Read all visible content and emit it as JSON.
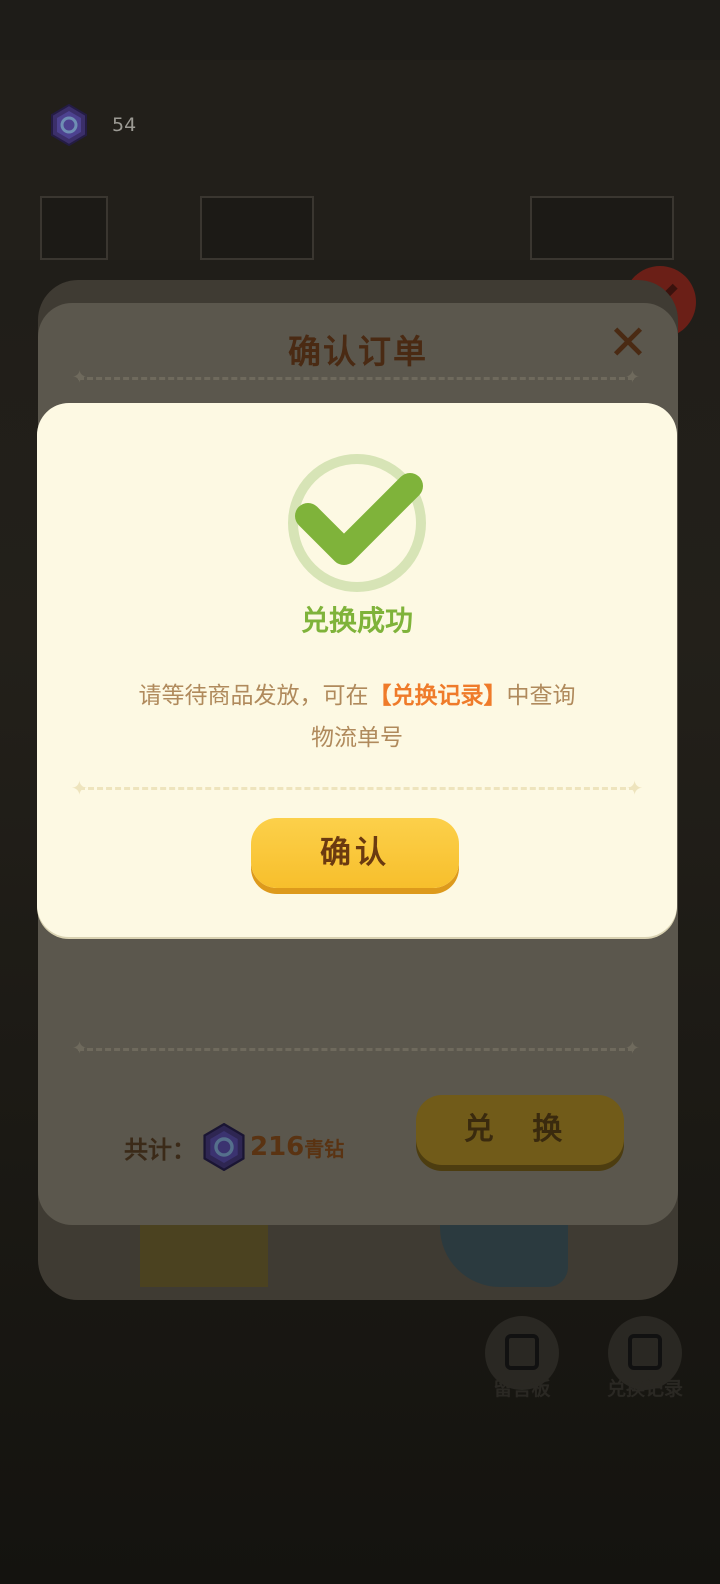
{
  "header": {
    "gem_count": "54"
  },
  "order_dialog": {
    "title": "确认订单",
    "total_label": "共计：",
    "total_amount": "216",
    "total_unit": "青钻",
    "exchange_label": "兑 换"
  },
  "floating_actions": {
    "message_board": "留言板",
    "exchange_records": "兑换记录"
  },
  "success_dialog": {
    "title": "兑换成功",
    "message_prefix": "请等待商品发放，可在",
    "message_link": "【兑换记录】",
    "message_suffix": "中查询",
    "message_line2": "物流单号",
    "confirm_label": "确认"
  },
  "colors": {
    "success_green": "#7fb33a",
    "highlight_orange": "#ef7b2a",
    "button_yellow": "#f7bf2c",
    "dialog_bg": "#fdf9e3"
  }
}
